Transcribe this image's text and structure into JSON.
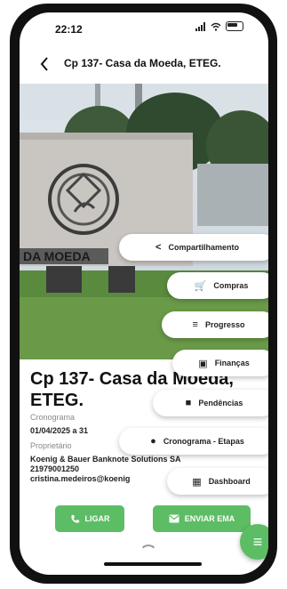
{
  "status": {
    "time": "22:12"
  },
  "header": {
    "title": "Cp 137- Casa da Moeda, ETEG."
  },
  "hero": {
    "sign_text": "DA MOEDA"
  },
  "project": {
    "title": "Cp 137- Casa da Moeda, ETEG.",
    "schedule_label": "Cronograma",
    "schedule_value": "01/04/2025 a 31",
    "owner_label": "Proprietário",
    "owner_name": "Koenig & Bauer Banknote Solutions SA",
    "owner_phone": "21979001250",
    "owner_email": "cristina.medeiros@koenig"
  },
  "actions": {
    "call_label": "LIGAR",
    "email_label": "ENVIAR EMA"
  },
  "menu": [
    {
      "label": "Compartilhamento",
      "icon": "share-icon"
    },
    {
      "label": "Compras",
      "icon": "cart-icon"
    },
    {
      "label": "Progresso",
      "icon": "progress-icon"
    },
    {
      "label": "Finanças",
      "icon": "money-icon"
    },
    {
      "label": "Pendências",
      "icon": "document-icon"
    },
    {
      "label": "Cronograma - Etapas",
      "icon": "clock-icon"
    },
    {
      "label": "Dashboard",
      "icon": "dashboard-icon"
    }
  ],
  "colors": {
    "accent": "#5cbd64"
  }
}
